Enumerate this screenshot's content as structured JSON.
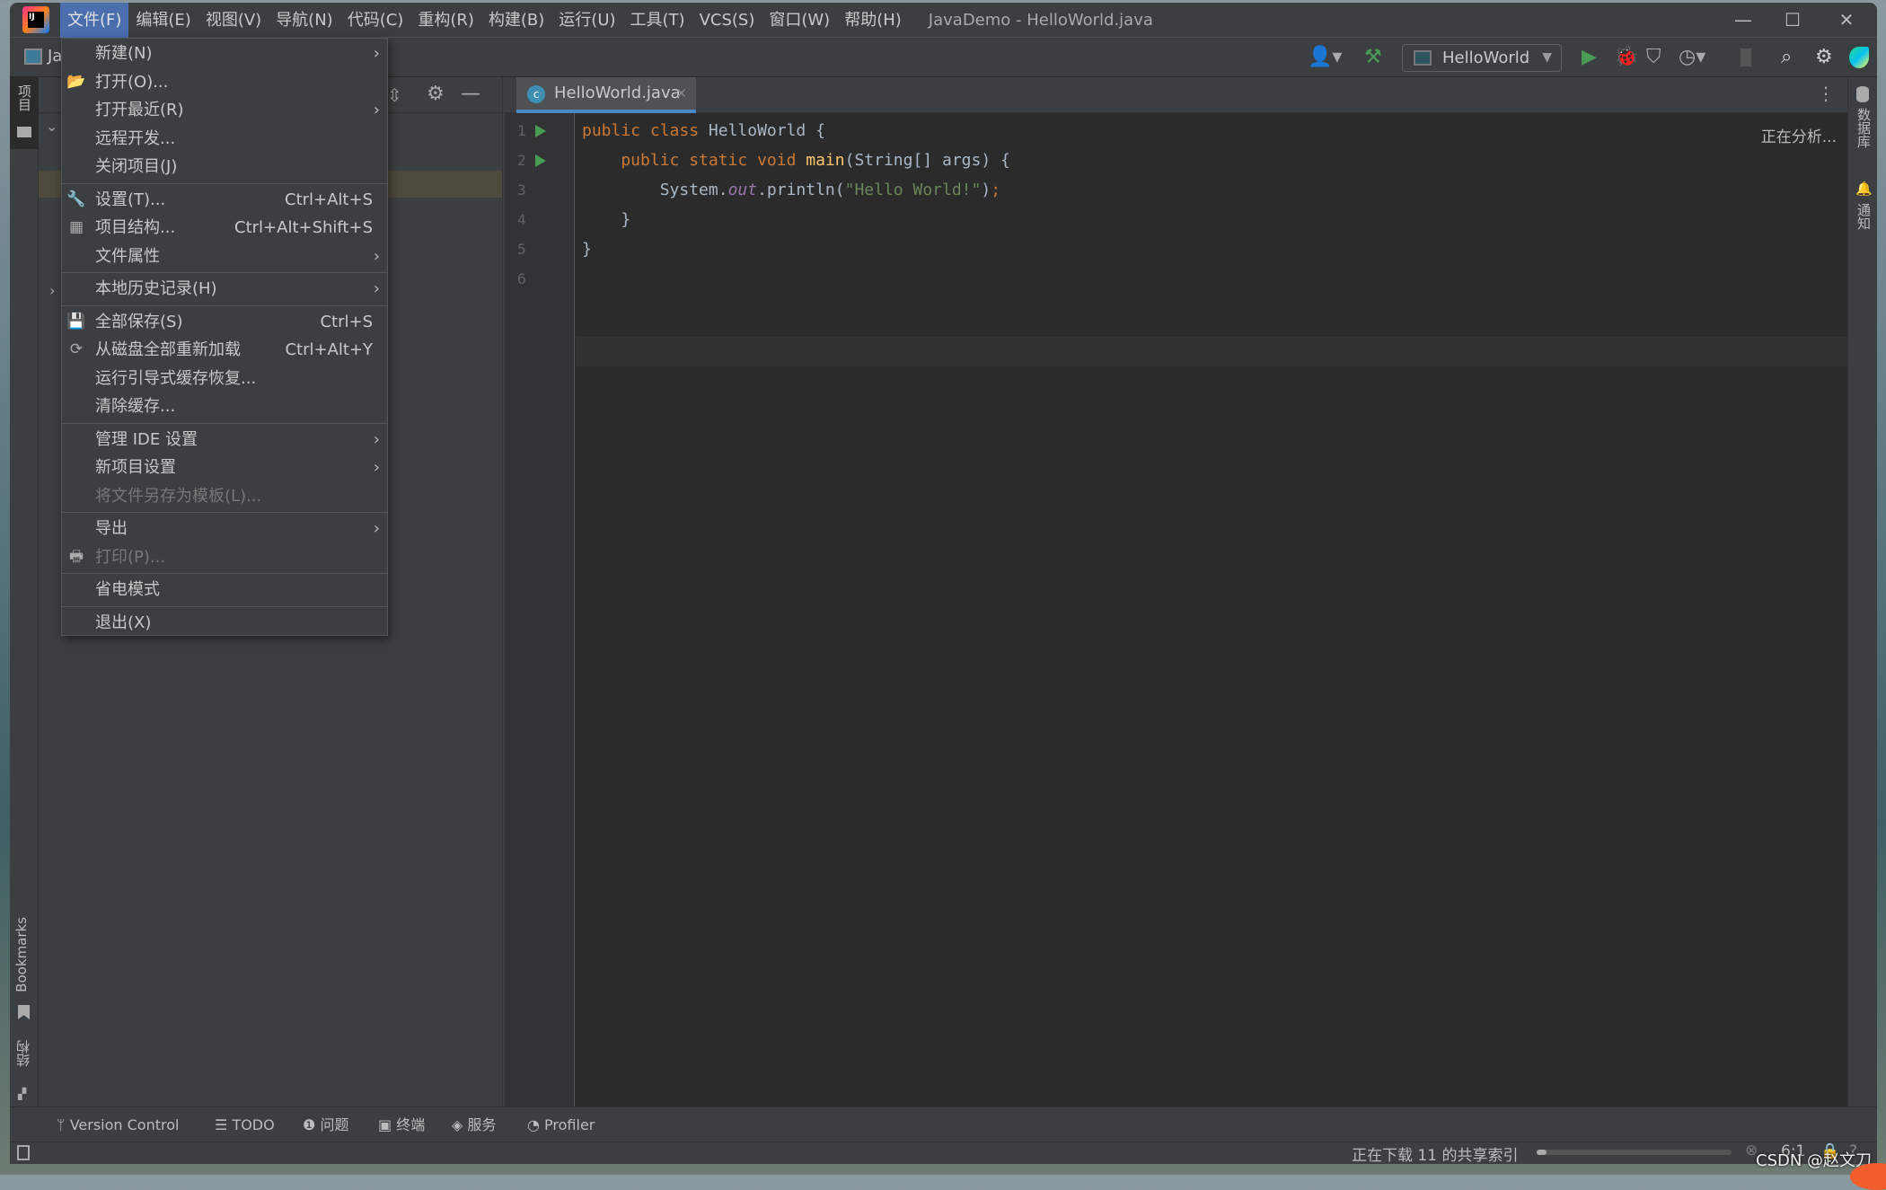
{
  "window": {
    "title": "JavaDemo - HelloWorld.java",
    "minimize": "—",
    "maximize": "☐",
    "close": "✕"
  },
  "menubar": [
    "文件(F)",
    "编辑(E)",
    "视图(V)",
    "导航(N)",
    "代码(C)",
    "重构(R)",
    "构建(B)",
    "运行(U)",
    "工具(T)",
    "VCS(S)",
    "窗口(W)",
    "帮助(H)"
  ],
  "navbar": {
    "breadcrumb": "Ja",
    "run_config": "HelloWorld"
  },
  "left_stripe": {
    "project": "项目",
    "bookmarks": "Bookmarks",
    "structure": "结构"
  },
  "right_stripe": {
    "database": "数据库",
    "notifications": "通知"
  },
  "editor": {
    "tab": "HelloWorld.java",
    "status": "正在分析...",
    "line_numbers": [
      "1",
      "2",
      "3",
      "4",
      "5",
      "6"
    ],
    "lines": [
      [
        {
          "t": "public class ",
          "c": "kw"
        },
        {
          "t": "HelloWorld {",
          "c": ""
        }
      ],
      [
        {
          "t": "    public static void ",
          "c": "kw"
        },
        {
          "t": "main",
          "c": "fn"
        },
        {
          "t": "(String[] args) {",
          "c": ""
        }
      ],
      [
        {
          "t": "        System.",
          "c": ""
        },
        {
          "t": "out",
          "c": "fld"
        },
        {
          "t": ".println(",
          "c": ""
        },
        {
          "t": "\"Hello World!\"",
          "c": "st"
        },
        {
          "t": ")",
          "c": ""
        },
        {
          "t": ";",
          "c": "kw"
        }
      ],
      [
        {
          "t": "    }",
          "c": ""
        }
      ],
      [
        {
          "t": "}",
          "c": ""
        }
      ],
      []
    ]
  },
  "file_menu": [
    {
      "label": "新建(N)",
      "submenu": true
    },
    {
      "label": "打开(O)...",
      "icon": "folder-open"
    },
    {
      "label": "打开最近(R)",
      "submenu": true
    },
    {
      "label": "远程开发..."
    },
    {
      "label": "关闭项目(J)"
    },
    "sep",
    {
      "label": "设置(T)...",
      "shortcut": "Ctrl+Alt+S",
      "icon": "wrench"
    },
    {
      "label": "项目结构...",
      "shortcut": "Ctrl+Alt+Shift+S",
      "icon": "project-structure"
    },
    {
      "label": "文件属性",
      "submenu": true
    },
    "sep",
    {
      "label": "本地历史记录(H)",
      "submenu": true
    },
    "sep",
    {
      "label": "全部保存(S)",
      "shortcut": "Ctrl+S",
      "icon": "save"
    },
    {
      "label": "从磁盘全部重新加载",
      "shortcut": "Ctrl+Alt+Y",
      "icon": "refresh"
    },
    {
      "label": "运行引导式缓存恢复..."
    },
    {
      "label": "清除缓存..."
    },
    "sep",
    {
      "label": "管理 IDE 设置",
      "submenu": true
    },
    {
      "label": "新项目设置",
      "submenu": true
    },
    {
      "label": "将文件另存为模板(L)...",
      "disabled": true
    },
    "sep",
    {
      "label": "导出",
      "submenu": true
    },
    {
      "label": "打印(P)...",
      "disabled": true,
      "icon": "printer"
    },
    "sep",
    {
      "label": "省电模式"
    },
    "sep",
    {
      "label": "退出(X)"
    }
  ],
  "bottom_tools": [
    "Version Control",
    "TODO",
    "问题",
    "终端",
    "服务",
    "Profiler"
  ],
  "statusbar": {
    "task": "正在下载 11 的共享索引",
    "progress": 0.05,
    "position": "6:1",
    "watermark": "CSDN @赵文刀"
  },
  "colors": {
    "accent": "#4b6eaf",
    "tab_underline": "#4a88c7",
    "run_green": "#499c54",
    "keyword": "#cc7832",
    "string": "#6a8759"
  }
}
